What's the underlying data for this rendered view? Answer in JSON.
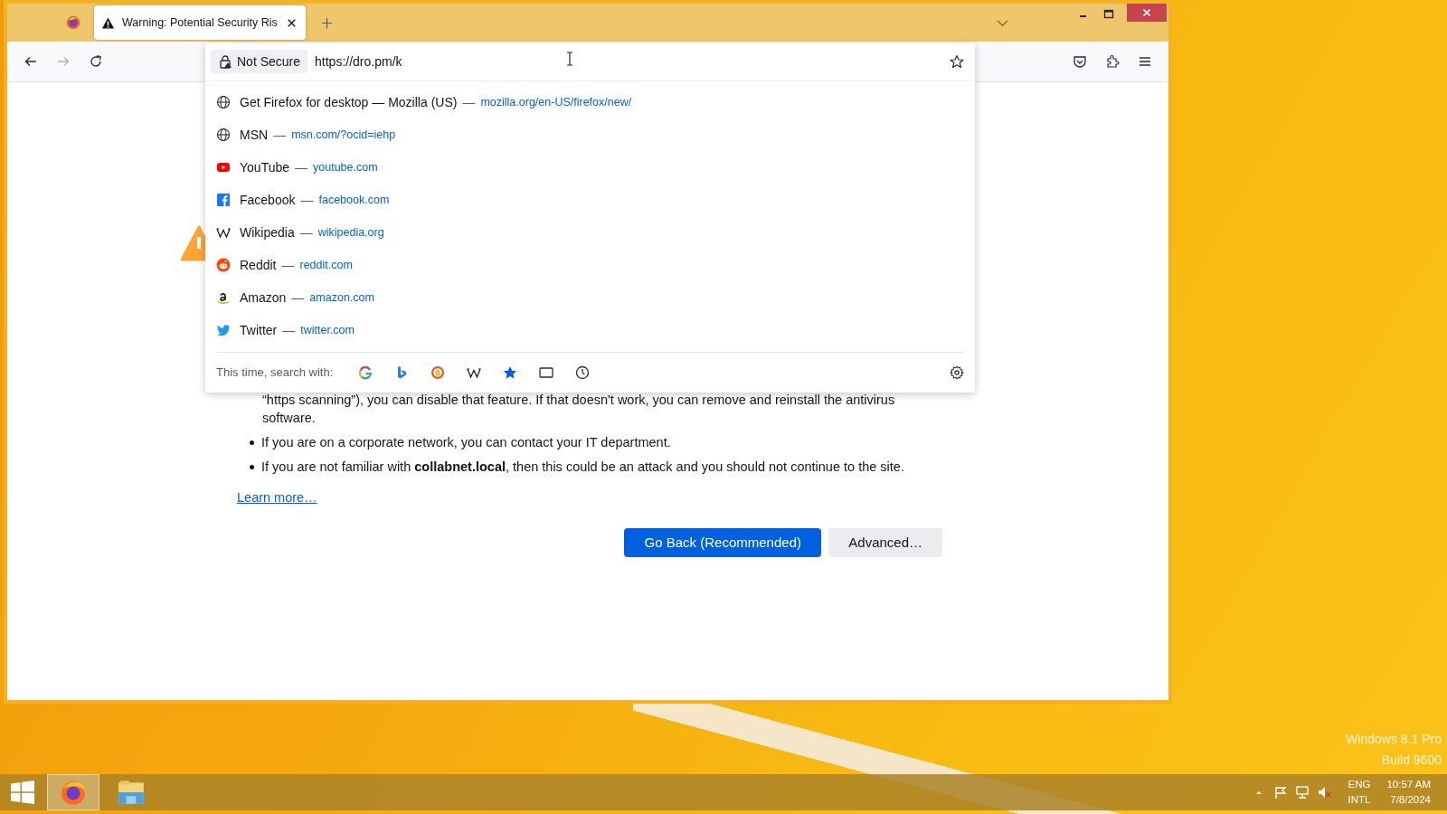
{
  "tabs": [
    {
      "kind": "pinned",
      "selected": false
    },
    {
      "kind": "page",
      "title": "Warning: Potential Security Ris",
      "selected": true
    }
  ],
  "urlbar": {
    "security": "Not Secure",
    "url": "https://dro.pm/k"
  },
  "suggestions": [
    {
      "kind": "globe",
      "title": "Get Firefox for desktop — Mozilla (US)",
      "separator": "—",
      "url": "mozilla.org/en-US/firefox/new/"
    },
    {
      "kind": "globe",
      "title": "MSN",
      "separator": "—",
      "url": "msn.com/?ocid=iehp"
    },
    {
      "kind": "youtube",
      "title": "YouTube",
      "separator": "—",
      "url": "youtube.com"
    },
    {
      "kind": "facebook",
      "title": "Facebook",
      "separator": "—",
      "url": "facebook.com"
    },
    {
      "kind": "wikipedia",
      "title": "Wikipedia",
      "separator": "—",
      "url": "wikipedia.org"
    },
    {
      "kind": "reddit",
      "title": "Reddit",
      "separator": "—",
      "url": "reddit.com"
    },
    {
      "kind": "amazon",
      "title": "Amazon",
      "separator": "—",
      "url": "amazon.com"
    },
    {
      "kind": "twitter",
      "title": "Twitter",
      "separator": "—",
      "url": "twitter.com"
    }
  ],
  "search_with": {
    "label": "This time, search with:",
    "engines": [
      {
        "kind": "google"
      },
      {
        "kind": "bing"
      },
      {
        "kind": "duckduckgo"
      },
      {
        "kind": "wikipedia"
      },
      {
        "kind": "bookmarks"
      },
      {
        "kind": "tabs"
      },
      {
        "kind": "history"
      }
    ]
  },
  "page": {
    "partial_text": "“https scanning”), you can disable that feature. If that doesn't work, you can remove and reinstall the antivirus software.",
    "bullets": [
      "If you are on a corporate network, you can contact your IT department.",
      "If you are not familiar with **collabnet.local**, then this could be an attack and you should not continue to the site."
    ],
    "learn_more": "Learn more…",
    "buttons": [
      {
        "label": "Go Back (Recommended)",
        "primary": true
      },
      {
        "label": "Advanced…",
        "primary": false
      }
    ]
  },
  "desktop": {
    "edition": "Windows 8.1 Pro",
    "build": "Build 9600"
  },
  "taskbar": {
    "apps": [
      {
        "kind": "firefox",
        "selected": true
      },
      {
        "kind": "explorer",
        "selected": false
      }
    ],
    "language": "ENG",
    "layout": "INTL",
    "time": "10:57 AM",
    "date": "7/8/2024"
  }
}
